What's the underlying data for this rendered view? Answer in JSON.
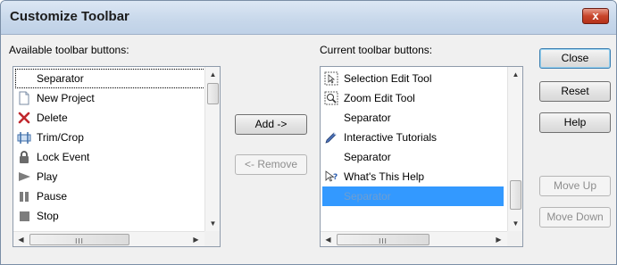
{
  "window": {
    "title": "Customize Toolbar",
    "close_glyph": "x"
  },
  "available": {
    "label": "Available toolbar buttons:",
    "items": [
      {
        "label": "Separator",
        "icon": ""
      },
      {
        "label": "New Project",
        "icon": "new-project-icon"
      },
      {
        "label": "Delete",
        "icon": "delete-icon"
      },
      {
        "label": "Trim/Crop",
        "icon": "trim-crop-icon"
      },
      {
        "label": "Lock Event",
        "icon": "lock-icon"
      },
      {
        "label": "Play",
        "icon": "play-icon"
      },
      {
        "label": "Pause",
        "icon": "pause-icon"
      },
      {
        "label": "Stop",
        "icon": "stop-icon"
      }
    ]
  },
  "current": {
    "label": "Current toolbar buttons:",
    "items": [
      {
        "label": "Selection Edit Tool",
        "icon": "selection-edit-tool-icon"
      },
      {
        "label": "Zoom Edit Tool",
        "icon": "zoom-edit-tool-icon"
      },
      {
        "label": "Separator",
        "icon": ""
      },
      {
        "label": "Interactive Tutorials",
        "icon": "interactive-tutorials-icon"
      },
      {
        "label": "Separator",
        "icon": ""
      },
      {
        "label": "What's This Help",
        "icon": "whats-this-help-icon"
      },
      {
        "label": "Separator",
        "icon": ""
      }
    ]
  },
  "buttons": {
    "add": "Add ->",
    "remove": "<- Remove",
    "close": "Close",
    "reset": "Reset",
    "help": "Help",
    "move_up": "Move Up",
    "move_down": "Move Down"
  },
  "scrollbar": {
    "grip": "III",
    "up": "▲",
    "down": "▼",
    "left": "◀",
    "right": "▶"
  }
}
